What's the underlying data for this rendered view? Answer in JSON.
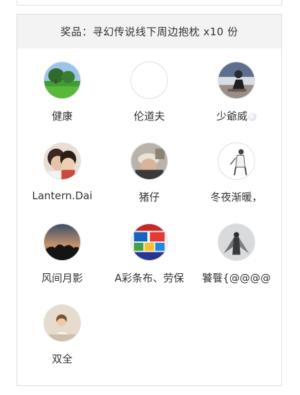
{
  "prize": {
    "title": "奖品：寻幻传说线下周边抱枕 x10 份"
  },
  "winners": [
    {
      "name": "健康",
      "avatar": "green-lawn-tree-photo"
    },
    {
      "name": "伦道夫",
      "avatar": "blank-white-avatar"
    },
    {
      "name": "少爺威",
      "avatar": "person-sitting-photo"
    },
    {
      "name": "Lantern.Dai",
      "avatar": "couple-kissing-photo"
    },
    {
      "name": "猪仔",
      "avatar": "person-with-hat-photo"
    },
    {
      "name": "冬夜渐暖，",
      "avatar": "standing-figure-sketch"
    },
    {
      "name": "风间月影",
      "avatar": "dusk-silhouette-photo"
    },
    {
      "name": "A彩条布、劳保",
      "avatar": "tarp-products-collage"
    },
    {
      "name": "饕餮{@@@@",
      "avatar": "winged-angel-art"
    },
    {
      "name": "双全",
      "avatar": "child-portrait-photo"
    }
  ],
  "colors": {
    "header_bg": "#f3f3f3",
    "text": "#333333",
    "border": "#dcdcdc"
  }
}
